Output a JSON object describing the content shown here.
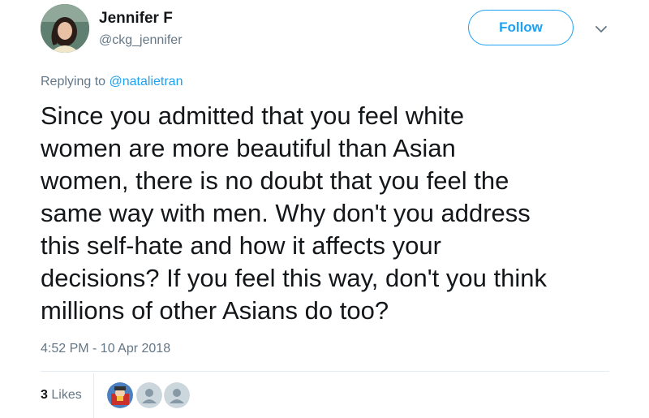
{
  "author": {
    "name": "Jennifer F",
    "handle": "@ckg_jennifer"
  },
  "follow_label": "Follow",
  "reply": {
    "prefix": "Replying to ",
    "mention": "@natalietran"
  },
  "tweet": {
    "text": "Since you admitted that you feel white\nwomen are more beautiful than  Asian\nwomen, there is no doubt that you feel the\nsame way with men. Why don't you address\nthis self-hate and how it affects your\ndecisions? If you feel this way, don't you think\nmillions of other Asians do too?"
  },
  "timestamp": "4:52 PM - 10 Apr 2018",
  "likes": {
    "count": "3",
    "label": "Likes"
  },
  "colors": {
    "accent": "#1da1f2",
    "muted": "#657786",
    "text": "#14171a",
    "divider": "#e6ecf0"
  },
  "icons": {
    "menu": "chevron-down-icon",
    "default_avatar": "default-avatar-icon"
  }
}
